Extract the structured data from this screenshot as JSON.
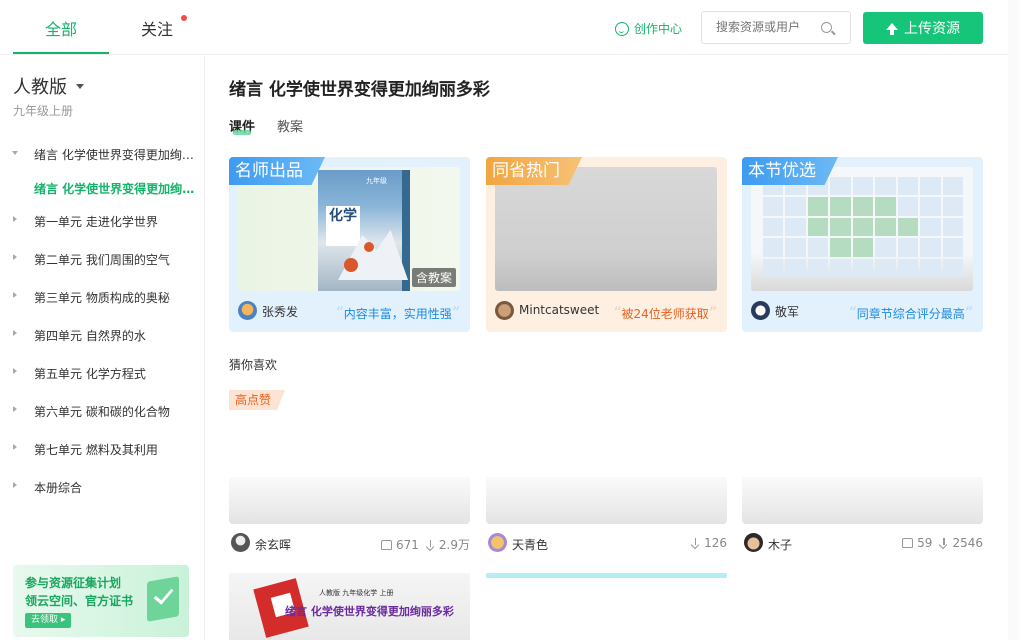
{
  "header": {
    "tabs": [
      {
        "label": "全部"
      },
      {
        "label": "关注"
      }
    ],
    "creator_center": "创作中心",
    "search_placeholder": "搜索资源或用户",
    "upload_label": "上传资源"
  },
  "sidebar": {
    "edition": "人教版",
    "grade": "九年级上册",
    "items": [
      {
        "label": "绪言 化学使世界变得更加绚丽多彩"
      },
      {
        "label": "绪言 化学使世界变得更加绚丽多彩"
      },
      {
        "label": "第一单元 走进化学世界"
      },
      {
        "label": "第二单元 我们周围的空气"
      },
      {
        "label": "第三单元 物质构成的奥秘"
      },
      {
        "label": "第四单元 自然界的水"
      },
      {
        "label": "第五单元 化学方程式"
      },
      {
        "label": "第六单元 碳和碳的化合物"
      },
      {
        "label": "第七单元 燃料及其利用"
      },
      {
        "label": "本册综合"
      }
    ],
    "promo": {
      "line1": "参与资源征集计划",
      "line2": "领云空间、官方证书",
      "button": "去领取 ▸"
    }
  },
  "main": {
    "title": "绪言 化学使世界变得更加绚丽多彩",
    "subtabs": [
      {
        "label": "课件"
      },
      {
        "label": "教案"
      }
    ],
    "featured": [
      {
        "badge": "名师出品",
        "author": "张秀发",
        "quote": "内容丰富，实用性强",
        "tag": "含教案",
        "book_title": "化学",
        "book_series": "九年级"
      },
      {
        "badge": "同省热门",
        "author": "Mintcatsweet",
        "quote": "被24位老师获取"
      },
      {
        "badge": "本节优选",
        "author": "敬军",
        "quote": "同章节综合评分最高"
      }
    ],
    "guess_title": "猜你喜欢",
    "hot_tag": "高点赞",
    "recommendations": [
      {
        "author": "余玄晖",
        "likes": "671",
        "downloads": "2.9万"
      },
      {
        "author": "天青色",
        "downloads": "126"
      },
      {
        "author": "木子",
        "likes": "59",
        "downloads": "2546"
      }
    ],
    "bottom_card": {
      "edition_line": "人教版  九年级化学  上册",
      "title": "绪言 化学使世界变得更加绚丽多彩"
    }
  },
  "colors": {
    "accent": "#16b36b",
    "upload_button": "#16c47a",
    "badge_blue": "#3e9bf0",
    "badge_orange": "#f2a53e"
  }
}
